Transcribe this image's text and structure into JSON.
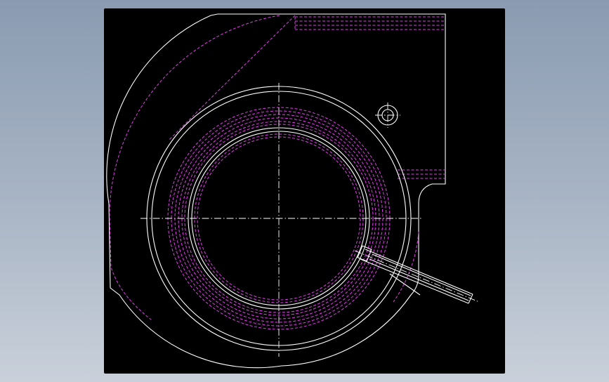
{
  "colors": {
    "background_top": "#8a9bb1",
    "background_bottom": "#c9d0da",
    "viewport": "#000000",
    "visible_edge": "#ffffff",
    "hidden_edge": "#e040e8",
    "center_line": "#ffffff"
  },
  "drawing": {
    "type": "cad-orthographic-view",
    "subject": "blower-housing-with-ring-and-outlet-tube",
    "line_styles": [
      "visible-solid",
      "hidden-dashed",
      "center-dash-dot"
    ]
  }
}
